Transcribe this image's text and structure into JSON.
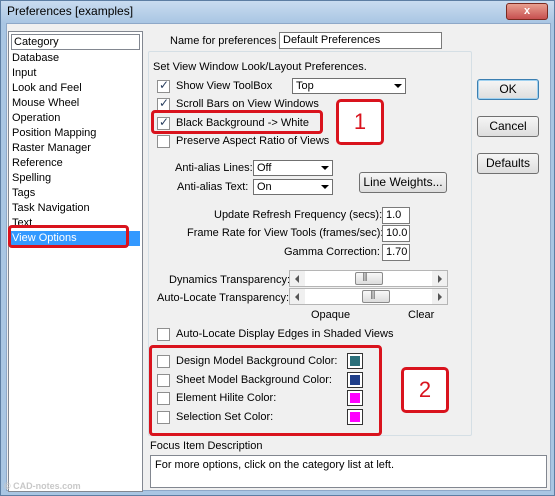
{
  "window": {
    "title": "Preferences [examples]",
    "close_label": "x"
  },
  "category": {
    "header": "Category",
    "items": [
      "Database",
      "Input",
      "Look and Feel",
      "Mouse Wheel",
      "Operation",
      "Position Mapping",
      "Raster Manager",
      "Reference",
      "Spelling",
      "Tags",
      "Task Navigation",
      "Text",
      "View Options"
    ],
    "selected": "View Options"
  },
  "name_row": {
    "label": "Name for preferences",
    "value": "Default Preferences"
  },
  "section_title": "Set View Window Look/Layout Preferences.",
  "options": {
    "show_toolbox": {
      "label": "Show View ToolBox",
      "checked": true
    },
    "toolbox_position": "Top",
    "scroll_bars": {
      "label": "Scroll Bars on View Windows",
      "checked": true
    },
    "black_bg": {
      "label": "Black Background -> White",
      "checked": true
    },
    "preserve_aspect": {
      "label": "Preserve Aspect Ratio of Views",
      "checked": false
    },
    "antialias_lines": {
      "label": "Anti-alias Lines:",
      "value": "Off"
    },
    "antialias_text": {
      "label": "Anti-alias Text:",
      "value": "On"
    },
    "line_weights": "Line Weights...",
    "refresh_freq": {
      "label": "Update Refresh Frequency (secs):",
      "value": "1.0"
    },
    "frame_rate": {
      "label": "Frame Rate for View Tools (frames/sec):",
      "value": "10.0"
    },
    "gamma": {
      "label": "Gamma Correction:",
      "value": "1.70"
    },
    "dynamics_transparency": {
      "label": "Dynamics Transparency:",
      "level": 0.5
    },
    "autolocate_transparency": {
      "label": "Auto-Locate Transparency:",
      "level": 0.58
    },
    "opaque": "Opaque",
    "clear": "Clear",
    "autolocate_edges": {
      "label": "Auto-Locate Display Edges in Shaded Views",
      "checked": false
    }
  },
  "colors": [
    {
      "label": "Design Model Background Color:",
      "checked": false,
      "color": "#2a6f7a"
    },
    {
      "label": "Sheet Model Background Color:",
      "checked": false,
      "color": "#1f3f8a"
    },
    {
      "label": "Element Hilite Color:",
      "checked": false,
      "color": "#ff00ff"
    },
    {
      "label": "Selection Set Color:",
      "checked": false,
      "color": "#ff00ff"
    }
  ],
  "buttons": {
    "ok": "OK",
    "cancel": "Cancel",
    "defaults": "Defaults"
  },
  "focus": {
    "label": "Focus Item Description",
    "text": "For more options, click on the category list at left."
  },
  "annotations": {
    "one": "1",
    "two": "2",
    "accent": "#d9131d"
  },
  "watermark": "© CAD-notes.com"
}
